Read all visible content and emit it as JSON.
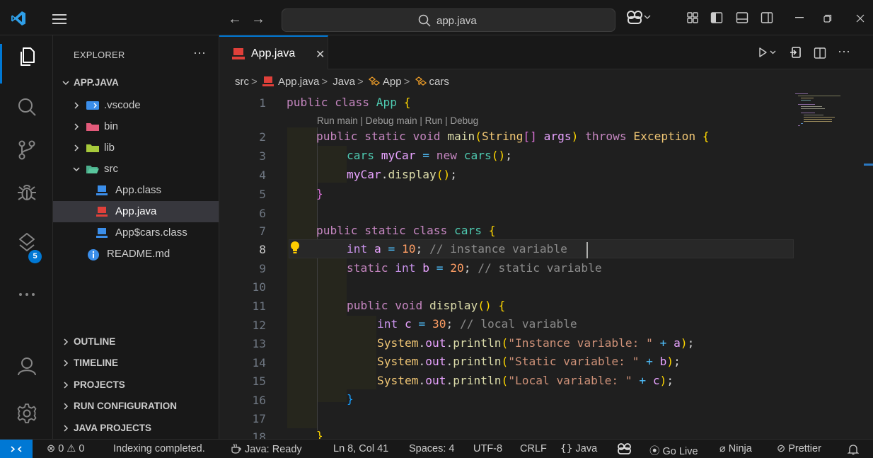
{
  "search": {
    "text": "app.java"
  },
  "sidebar": {
    "title": "EXPLORER",
    "root": "APP.JAVA",
    "tree": [
      {
        "label": ".vscode",
        "kind": "folder"
      },
      {
        "label": "bin",
        "kind": "folder"
      },
      {
        "label": "lib",
        "kind": "folder"
      },
      {
        "label": "src",
        "kind": "folder-open"
      },
      {
        "label": "App.class",
        "kind": "file"
      },
      {
        "label": "App.java",
        "kind": "file",
        "selected": true
      },
      {
        "label": "App$cars.class",
        "kind": "file"
      },
      {
        "label": "README.md",
        "kind": "file"
      }
    ],
    "sections": [
      "OUTLINE",
      "TIMELINE",
      "PROJECTS",
      "RUN CONFIGURATION",
      "JAVA PROJECTS"
    ]
  },
  "activity": {
    "extensions_badge": "5"
  },
  "editor": {
    "tab_label": "App.java",
    "breadcrumb": {
      "src": "src",
      "file": "App.java",
      "java": "Java",
      "app": "App",
      "cars": "cars"
    },
    "codelens": "Run main | Debug main | Run | Debug",
    "line_numbers": [
      "1",
      "2",
      "3",
      "4",
      "5",
      "6",
      "7",
      "8",
      "9",
      "10",
      "11",
      "12",
      "13",
      "14",
      "15",
      "16",
      "17",
      "18"
    ],
    "lines": {
      "l1": "public class App {",
      "l2": "public static void main(String[] args) throws Exception {",
      "l3": "cars myCar = new cars();",
      "l4": "myCar.display();",
      "l5": "}",
      "l7": "public static class cars {",
      "l8": "int a = 10; // instance variable",
      "l9": "static int b = 20; // static variable",
      "l11": "public void display() {",
      "l12": "int c = 30; // local variable",
      "l13": "System.out.println(\"Instance variable: \" + a);",
      "l14": "System.out.println(\"Static variable: \" + b);",
      "l15": "System.out.println(\"Local variable: \" + c);",
      "l16": "}",
      "l18": "}"
    }
  },
  "status": {
    "errors": "0",
    "warnings": "0",
    "indexing": "Indexing completed.",
    "java_ready": "Java: Ready",
    "position": "Ln 8, Col 41",
    "spaces": "Spaces: 4",
    "encoding": "UTF-8",
    "eol": "CRLF",
    "language": "Java",
    "go_live": "Go Live",
    "ninja": "Ninja",
    "prettier": "Prettier"
  },
  "colors": {
    "accent": "#0078d4",
    "java_icon": "#e0403a",
    "badge": "#0078d4"
  }
}
